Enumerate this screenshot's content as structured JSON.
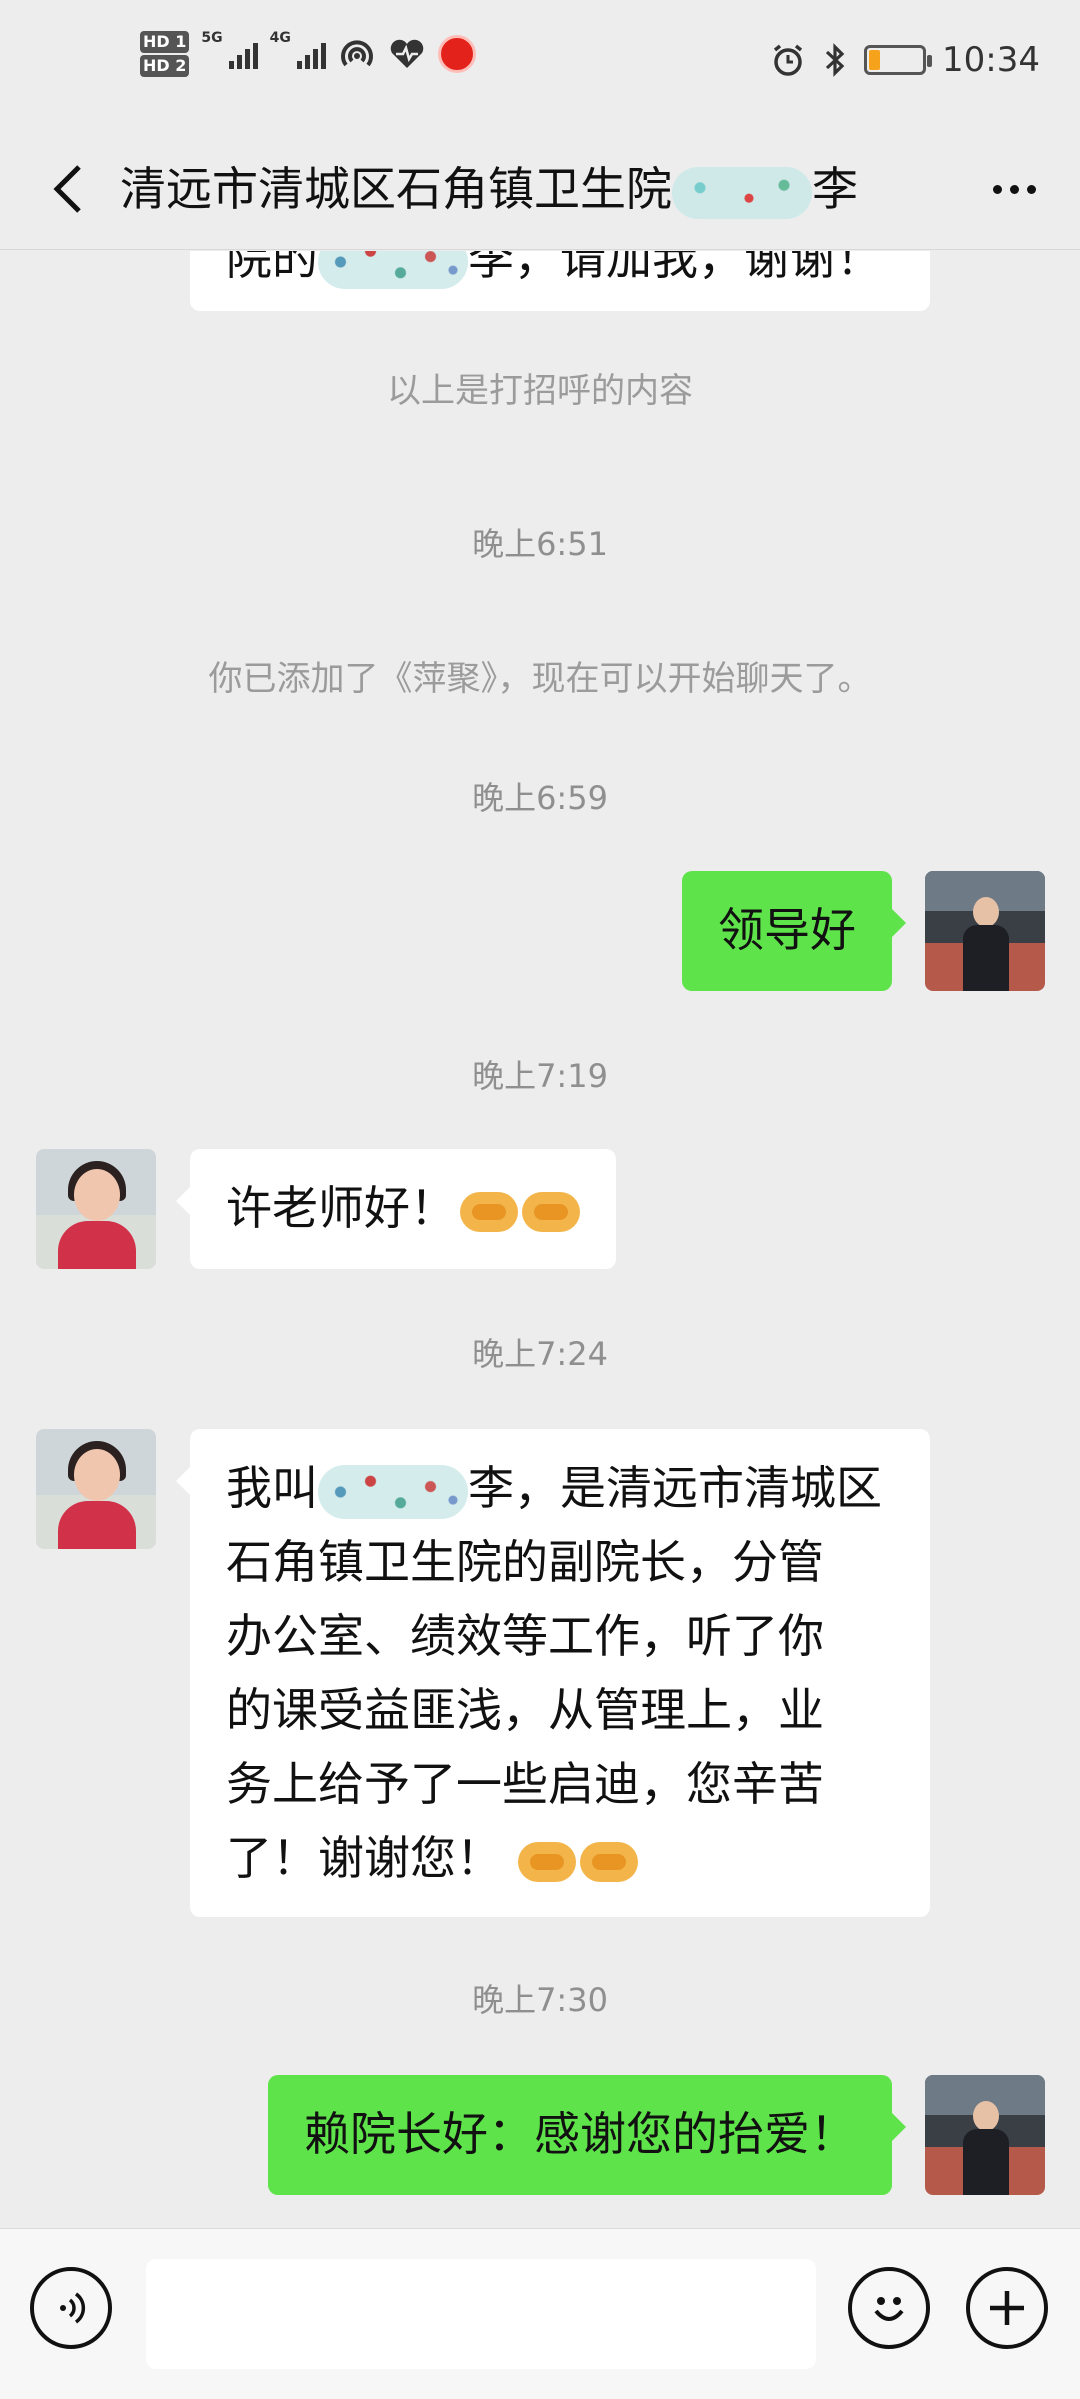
{
  "status_bar": {
    "hd1": "HD 1",
    "hd2": "HD 2",
    "net1": "5G",
    "net2": "4G",
    "time": "10:34",
    "battery_level": 0.2,
    "icons": [
      "signal-5g-icon",
      "signal-4g-icon",
      "hotspot-icon",
      "health-icon",
      "app-badge-icon",
      "alarm-icon",
      "bluetooth-icon",
      "battery-icon"
    ]
  },
  "header": {
    "title": "清远市清城区石角镇卫生院",
    "title_suffix": "李",
    "back_icon": "chevron-left-icon",
    "more_icon": "more-dots-icon"
  },
  "messages": [
    {
      "type": "text",
      "side": "left",
      "clipped": true,
      "parts": [
        "院的",
        "李，请加我，谢谢！"
      ]
    },
    {
      "type": "system",
      "text": "以上是打招呼的内容"
    },
    {
      "type": "time",
      "text": "晚上6:51"
    },
    {
      "type": "system",
      "text": "你已添加了《萍聚》，现在可以开始聊天了。"
    },
    {
      "type": "time",
      "text": "晚上6:59"
    },
    {
      "type": "text",
      "side": "right",
      "text": "领导好"
    },
    {
      "type": "time",
      "text": "晚上7:19"
    },
    {
      "type": "text",
      "side": "left",
      "text": "许老师好！",
      "emoji": [
        "handshake-emoji",
        "handshake-emoji"
      ]
    },
    {
      "type": "time",
      "text": "晚上7:24"
    },
    {
      "type": "text",
      "side": "left",
      "lines": [
        "我叫",
        "李，是清远市清城区",
        "石角镇卫生院的副院长，分管",
        "办公室、绩效等工作，听了你",
        "的课受益匪浅，从管理上，业",
        "务上给予了一些启迪，您辛苦",
        "了！谢谢您！"
      ],
      "emoji": [
        "handshake-emoji",
        "handshake-emoji"
      ]
    },
    {
      "type": "time",
      "text": "晚上7:30"
    },
    {
      "type": "text",
      "side": "right",
      "text": "赖院长好：感谢您的抬爱！"
    }
  ],
  "input_bar": {
    "voice_icon": "voice-icon",
    "emoji_icon": "emoji-icon",
    "plus_icon": "plus-icon",
    "input_value": ""
  },
  "colors": {
    "background": "#ededed",
    "green_bubble": "#5fe34a",
    "white_bubble": "#ffffff",
    "timestamp": "#8f8f8f"
  }
}
